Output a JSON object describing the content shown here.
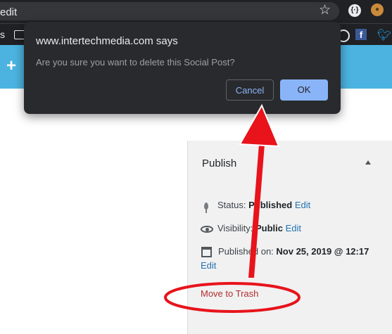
{
  "browser": {
    "url_fragment": "edit",
    "bookmarks_partial": "s"
  },
  "dialog": {
    "title": "www.intertechmedia.com says",
    "message": "Are you sure you want to delete this Social Post?",
    "cancel_label": "Cancel",
    "ok_label": "OK"
  },
  "wp": {
    "add_new_symbol": "+"
  },
  "publish": {
    "title": "Publish",
    "status_label": "Status: ",
    "status_value": "Published",
    "status_edit": "Edit",
    "visibility_label": "Visibility: ",
    "visibility_value": "Public",
    "visibility_edit": "Edit",
    "published_label": "Published on: ",
    "published_value": "Nov 25, 2019 @ 12:17",
    "published_edit": "Edit",
    "trash_label": "Move to Trash"
  },
  "icons": {
    "star": "star-icon",
    "facebook": "facebook-icon",
    "twitter": "twitter-icon"
  },
  "colors": {
    "wp_bar": "#4cb3e0",
    "ok_button": "#8ab4f8",
    "annotation": "#e8131b",
    "trash_link": "#b32d2e"
  }
}
